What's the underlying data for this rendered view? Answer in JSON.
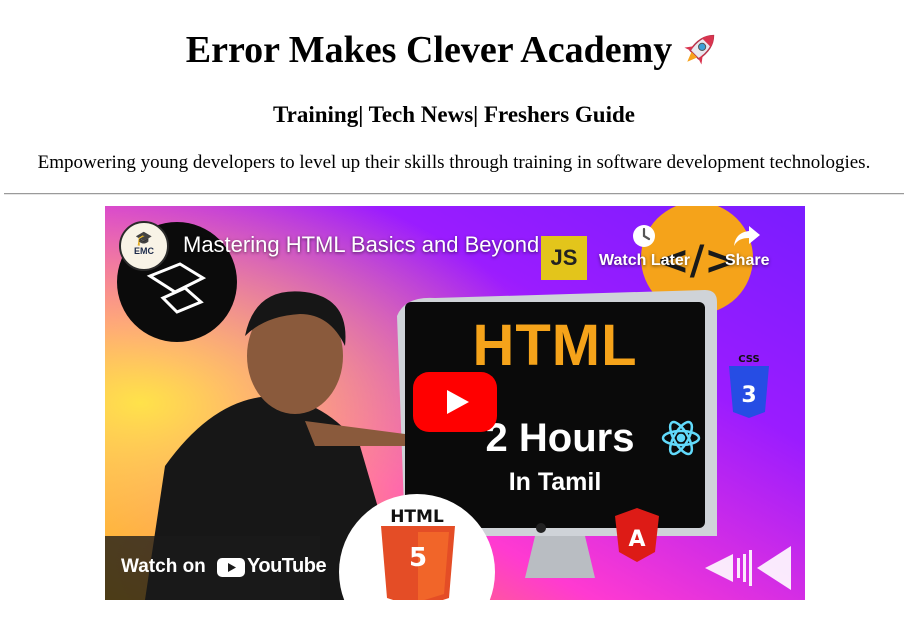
{
  "header": {
    "title": "Error Makes Clever Academy",
    "subtitle": "Training| Tech News| Freshers Guide",
    "tagline": "Empowering young developers to level up their skills through training in software development technologies."
  },
  "video": {
    "channel_badge": "EMC",
    "title": "Mastering HTML Basics and Beyond | ...",
    "watch_later_label": "Watch Later",
    "share_label": "Share",
    "watch_on_label": "Watch on",
    "youtube_label": "YouTube",
    "thumbnail": {
      "headline": "HTML",
      "duration": "2 Hours",
      "language": "In Tamil",
      "badge_js": "JS",
      "badge_html": "HTML",
      "badge_css": "CSS"
    }
  },
  "colors": {
    "youtube_red": "#ff0000",
    "thumbnail_purple": "#8a1cff",
    "thumbnail_orange": "#f5a31a"
  }
}
